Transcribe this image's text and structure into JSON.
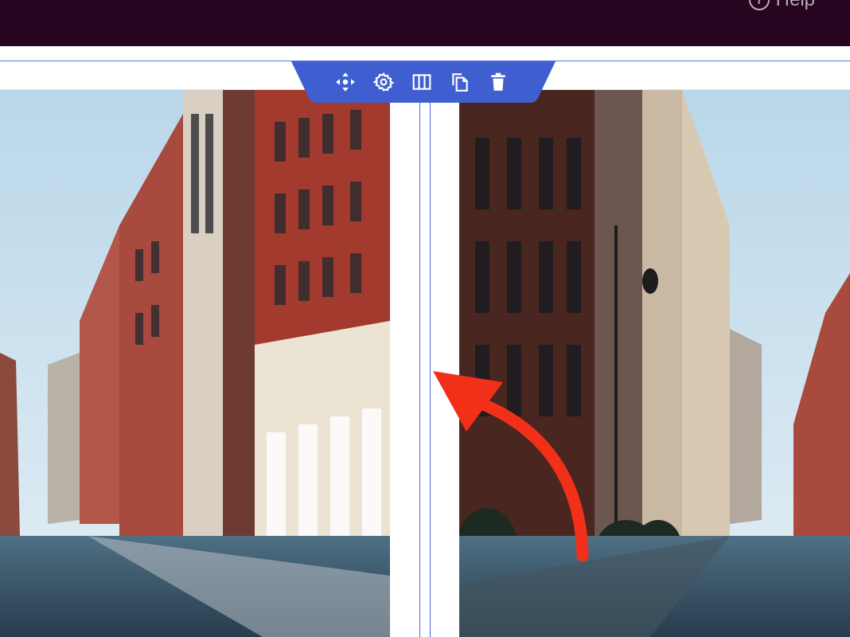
{
  "header": {
    "help_label": "Help",
    "help_icon": "info-circle-icon",
    "background": "#250520"
  },
  "toolbar": {
    "accent": "#3f5fd0",
    "tools": [
      {
        "name": "move",
        "icon": "move-arrows-icon"
      },
      {
        "name": "settings",
        "icon": "gear-icon"
      },
      {
        "name": "columns",
        "icon": "columns-icon"
      },
      {
        "name": "duplicate",
        "icon": "copy-icon"
      },
      {
        "name": "delete",
        "icon": "trash-icon"
      }
    ]
  },
  "annotation": {
    "icon": "curved-arrow-icon",
    "color": "#f2301a"
  },
  "photos": {
    "left": {
      "subject": "city-street-photo"
    },
    "right": {
      "subject": "city-street-photo-mirrored"
    }
  },
  "guides": {
    "color": "#4b64d0"
  }
}
